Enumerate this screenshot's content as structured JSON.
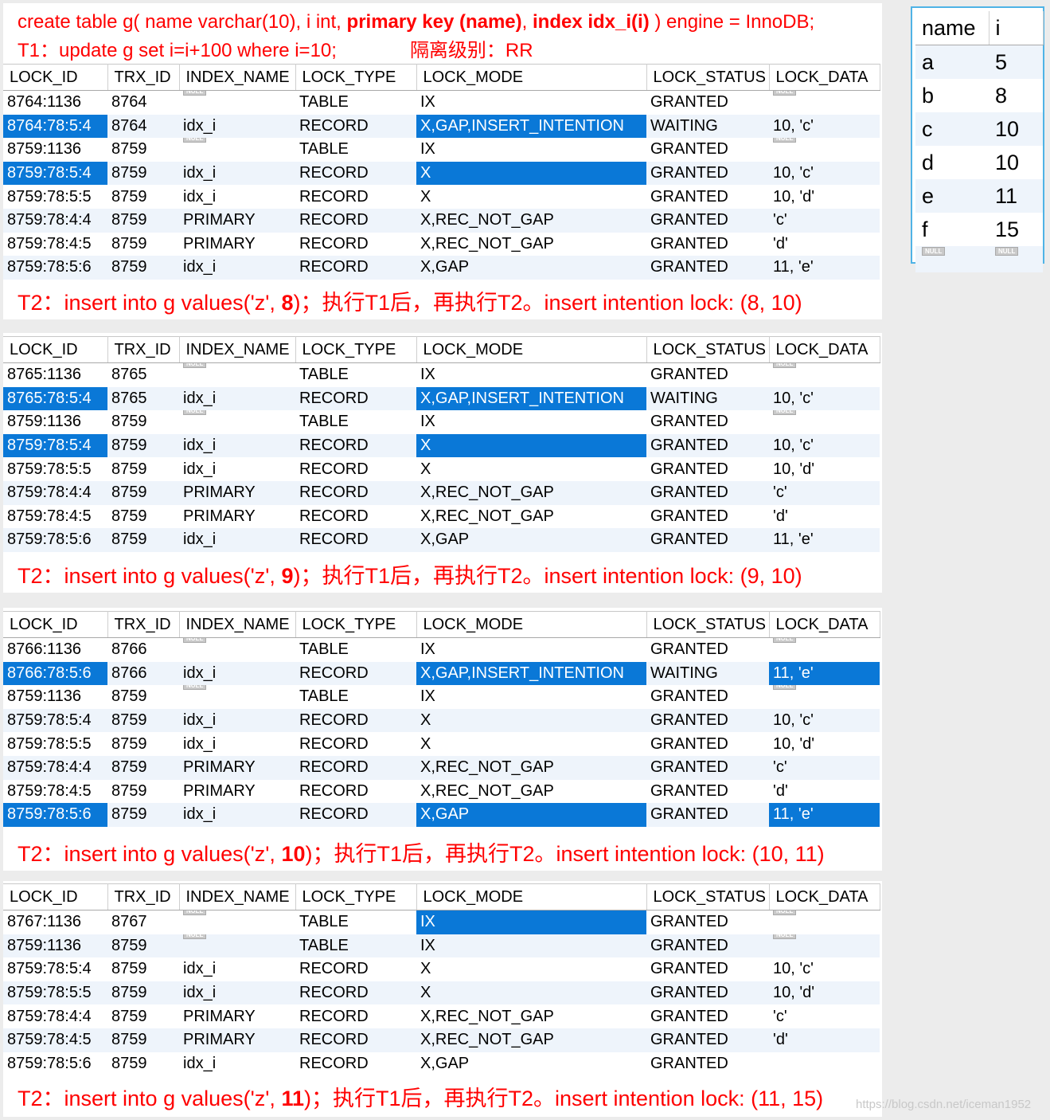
{
  "header": {
    "line1_a": "create table g( name varchar(10), i int, ",
    "line1_b": "primary key (name)",
    "line1_c": ", ",
    "line1_d": "index idx_i(i)",
    "line1_e": " ) engine = InnoDB;",
    "line2": "T1：update g set i=i+100 where i=10;",
    "line2_level": "隔离级别：RR"
  },
  "columns": [
    "LOCK_ID",
    "TRX_ID",
    "INDEX_NAME",
    "LOCK_TYPE",
    "LOCK_MODE",
    "LOCK_STATUS",
    "LOCK_DATA"
  ],
  "null_label": "NULL",
  "tables": [
    {
      "caption_pre": "T2：insert into g values('z', ",
      "caption_val": "8",
      "caption_post": ")；执行T1后，再执行T2。insert intention lock: (8, 10)",
      "rows": [
        [
          "8764:1136",
          "8764",
          null,
          "TABLE",
          "IX",
          "GRANTED",
          null
        ],
        [
          "8764:78:5:4",
          "8764",
          "idx_i",
          "RECORD",
          "X,GAP,INSERT_INTENTION",
          "WAITING",
          "10, 'c'"
        ],
        [
          "8759:1136",
          "8759",
          null,
          "TABLE",
          "IX",
          "GRANTED",
          null
        ],
        [
          "8759:78:5:4",
          "8759",
          "idx_i",
          "RECORD",
          "X",
          "GRANTED",
          "10, 'c'"
        ],
        [
          "8759:78:5:5",
          "8759",
          "idx_i",
          "RECORD",
          "X",
          "GRANTED",
          "10, 'd'"
        ],
        [
          "8759:78:4:4",
          "8759",
          "PRIMARY",
          "RECORD",
          "X,REC_NOT_GAP",
          "GRANTED",
          "'c'"
        ],
        [
          "8759:78:4:5",
          "8759",
          "PRIMARY",
          "RECORD",
          "X,REC_NOT_GAP",
          "GRANTED",
          "'d'"
        ],
        [
          "8759:78:5:6",
          "8759",
          "idx_i",
          "RECORD",
          "X,GAP",
          "GRANTED",
          "11, 'e'"
        ]
      ],
      "selected": [
        [
          1,
          0
        ],
        [
          1,
          4
        ],
        [
          3,
          0
        ],
        [
          3,
          4
        ]
      ]
    },
    {
      "caption_pre": "T2：insert into g values('z', ",
      "caption_val": "9",
      "caption_post": ")；执行T1后，再执行T2。insert intention lock: (9, 10)",
      "rows": [
        [
          "8765:1136",
          "8765",
          null,
          "TABLE",
          "IX",
          "GRANTED",
          null
        ],
        [
          "8765:78:5:4",
          "8765",
          "idx_i",
          "RECORD",
          "X,GAP,INSERT_INTENTION",
          "WAITING",
          "10, 'c'"
        ],
        [
          "8759:1136",
          "8759",
          null,
          "TABLE",
          "IX",
          "GRANTED",
          null
        ],
        [
          "8759:78:5:4",
          "8759",
          "idx_i",
          "RECORD",
          "X",
          "GRANTED",
          "10, 'c'"
        ],
        [
          "8759:78:5:5",
          "8759",
          "idx_i",
          "RECORD",
          "X",
          "GRANTED",
          "10, 'd'"
        ],
        [
          "8759:78:4:4",
          "8759",
          "PRIMARY",
          "RECORD",
          "X,REC_NOT_GAP",
          "GRANTED",
          "'c'"
        ],
        [
          "8759:78:4:5",
          "8759",
          "PRIMARY",
          "RECORD",
          "X,REC_NOT_GAP",
          "GRANTED",
          "'d'"
        ],
        [
          "8759:78:5:6",
          "8759",
          "idx_i",
          "RECORD",
          "X,GAP",
          "GRANTED",
          "11, 'e'"
        ]
      ],
      "selected": [
        [
          1,
          0
        ],
        [
          1,
          4
        ],
        [
          3,
          0
        ],
        [
          3,
          4
        ]
      ]
    },
    {
      "caption_pre": "T2：insert into g values('z', ",
      "caption_val": "10",
      "caption_post": ")；执行T1后，再执行T2。insert intention lock: (10, 11)",
      "rows": [
        [
          "8766:1136",
          "8766",
          null,
          "TABLE",
          "IX",
          "GRANTED",
          null
        ],
        [
          "8766:78:5:6",
          "8766",
          "idx_i",
          "RECORD",
          "X,GAP,INSERT_INTENTION",
          "WAITING",
          "11, 'e'"
        ],
        [
          "8759:1136",
          "8759",
          null,
          "TABLE",
          "IX",
          "GRANTED",
          null
        ],
        [
          "8759:78:5:4",
          "8759",
          "idx_i",
          "RECORD",
          "X",
          "GRANTED",
          "10, 'c'"
        ],
        [
          "8759:78:5:5",
          "8759",
          "idx_i",
          "RECORD",
          "X",
          "GRANTED",
          "10, 'd'"
        ],
        [
          "8759:78:4:4",
          "8759",
          "PRIMARY",
          "RECORD",
          "X,REC_NOT_GAP",
          "GRANTED",
          "'c'"
        ],
        [
          "8759:78:4:5",
          "8759",
          "PRIMARY",
          "RECORD",
          "X,REC_NOT_GAP",
          "GRANTED",
          "'d'"
        ],
        [
          "8759:78:5:6",
          "8759",
          "idx_i",
          "RECORD",
          "X,GAP",
          "GRANTED",
          "11, 'e'"
        ]
      ],
      "selected": [
        [
          1,
          0
        ],
        [
          1,
          4
        ],
        [
          1,
          6
        ],
        [
          7,
          0
        ],
        [
          7,
          4
        ],
        [
          7,
          6
        ]
      ]
    },
    {
      "caption_pre": "T2：insert into g values('z', ",
      "caption_val": "11",
      "caption_post": ")；执行T1后，再执行T2。insert intention lock: (11, 15)",
      "rows": [
        [
          "8767:1136",
          "8767",
          null,
          "TABLE",
          "IX",
          "GRANTED",
          null
        ],
        [
          "8759:1136",
          "8759",
          null,
          "TABLE",
          "IX",
          "GRANTED",
          null
        ],
        [
          "8759:78:5:4",
          "8759",
          "idx_i",
          "RECORD",
          "X",
          "GRANTED",
          "10, 'c'"
        ],
        [
          "8759:78:5:5",
          "8759",
          "idx_i",
          "RECORD",
          "X",
          "GRANTED",
          "10, 'd'"
        ],
        [
          "8759:78:4:4",
          "8759",
          "PRIMARY",
          "RECORD",
          "X,REC_NOT_GAP",
          "GRANTED",
          "'c'"
        ],
        [
          "8759:78:4:5",
          "8759",
          "PRIMARY",
          "RECORD",
          "X,REC_NOT_GAP",
          "GRANTED",
          "'d'"
        ],
        [
          "8759:78:5:6",
          "8759",
          "idx_i",
          "RECORD",
          "X,GAP",
          "GRANTED",
          ""
        ]
      ],
      "selected": [
        [
          0,
          4
        ]
      ]
    }
  ],
  "side_table": {
    "columns": [
      "name",
      "i"
    ],
    "rows": [
      [
        "a",
        "5"
      ],
      [
        "b",
        "8"
      ],
      [
        "c",
        "10"
      ],
      [
        "d",
        "10"
      ],
      [
        "e",
        "11"
      ],
      [
        "f",
        "15"
      ]
    ]
  },
  "watermark": "https://blog.csdn.net/iceman1952",
  "colors": {
    "caption": "#ff0000",
    "selection": "#0a78d7",
    "stripe": "#eef4fb",
    "side_border": "#4fb3e6"
  }
}
